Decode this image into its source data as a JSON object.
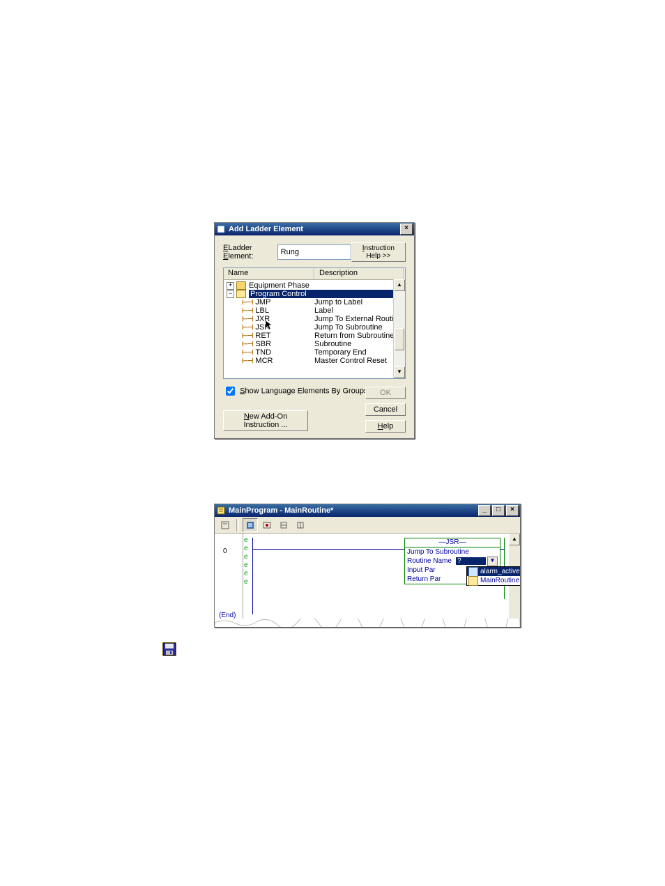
{
  "dialog1": {
    "title": "Add Ladder Element",
    "label_ladder_element": "Ladder Element:",
    "ladder_element_value": "Rung",
    "btn_instruction_help": "Instruction Help >>",
    "col_name": "Name",
    "col_description": "Description",
    "tree": {
      "equipment_phase": "Equipment Phase",
      "program_control": "Program Control",
      "items": [
        {
          "code": "JMP",
          "desc": "Jump to Label"
        },
        {
          "code": "LBL",
          "desc": "Label"
        },
        {
          "code": "JXR",
          "desc": "Jump To External Routine"
        },
        {
          "code": "JSR",
          "desc": "Jump To Subroutine"
        },
        {
          "code": "RET",
          "desc": "Return from Subroutine"
        },
        {
          "code": "SBR",
          "desc": "Subroutine"
        },
        {
          "code": "TND",
          "desc": "Temporary End"
        },
        {
          "code": "MCR",
          "desc": "Master Control Reset"
        }
      ]
    },
    "chk_show_groups": "Show Language Elements By Groups",
    "btn_ok": "OK",
    "btn_cancel": "Cancel",
    "btn_help": "Help",
    "btn_new_aoi": "New Add-On Instruction ..."
  },
  "window2": {
    "title": "MainProgram - MainRoutine*",
    "rung0": "0",
    "end": "(End)",
    "e_marker": "e",
    "jsr": {
      "header": "JSR",
      "line1": "Jump To Subroutine",
      "routine_name_k": "Routine Name",
      "routine_name_v": "?",
      "input_par": "Input Par",
      "return_par": "Return Par"
    },
    "dropdown": {
      "item0": "alarm_active",
      "item1": "MainRoutine"
    }
  }
}
